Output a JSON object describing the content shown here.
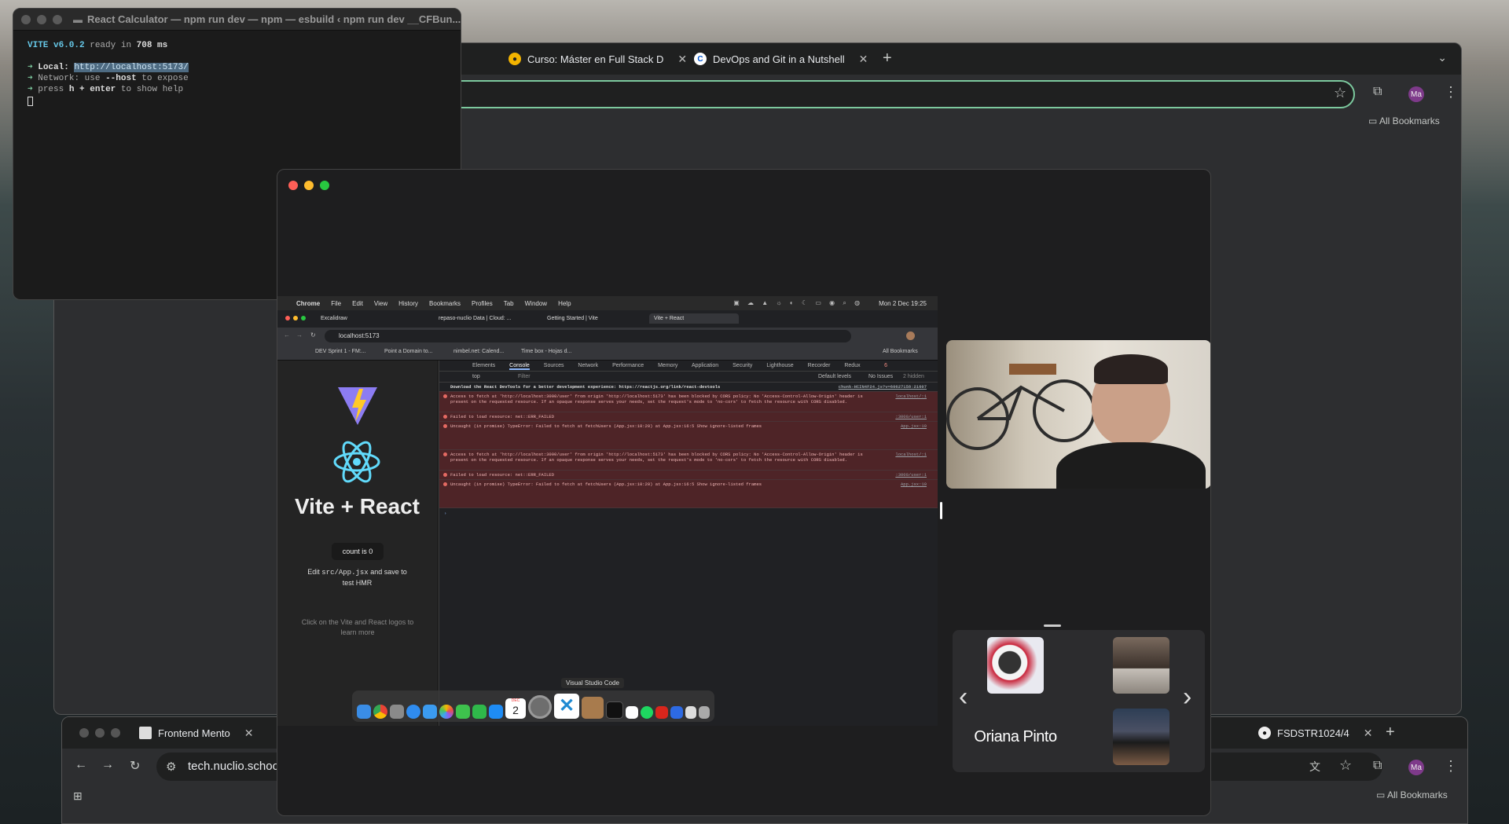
{
  "terminal": {
    "title": "React Calculator — npm run dev — npm — esbuild ‹ npm run dev __CFBun...",
    "vite_name": "VITE v6.0.2",
    "ready_text": "ready in",
    "ready_ms": "708 ms",
    "local_label": "Local:",
    "local_url": "http://localhost:5173/",
    "network_label": "Network:",
    "network_pre": "use",
    "network_flag": "--host",
    "network_post": "to expose",
    "help_pre": "press",
    "help_key": "h + enter",
    "help_post": "to show help"
  },
  "back_browser": {
    "tabs": [
      {
        "label": "Curso: Máster en Full Stack D"
      },
      {
        "label": "DevOps and Git in a Nutshell"
      }
    ],
    "all_bookmarks": "All Bookmarks",
    "profile_initials": "Ma"
  },
  "bottom_browser": {
    "tabs": [
      {
        "label": "Frontend Mento"
      },
      {
        "label": "FSDSTR1024/4"
      }
    ],
    "url": "tech.nuclio.schoo",
    "all_bookmarks": "All Bookmarks",
    "profile_initials": "Ma"
  },
  "shared_screen": {
    "macos_menu": [
      "Chrome",
      "File",
      "Edit",
      "View",
      "History",
      "Bookmarks",
      "Profiles",
      "Tab",
      "Window",
      "Help"
    ],
    "clock": "Mon 2 Dec 19:25",
    "tabs": [
      {
        "label": "Excalidraw"
      },
      {
        "label": "repaso-nuclio Data | Cloud: ..."
      },
      {
        "label": "Getting Started | Vite"
      },
      {
        "label": "Vite + React"
      }
    ],
    "url": "localhost:5173",
    "bookmarks": [
      "DEV Sprint 1 - FM:...",
      "Point a Domain to...",
      "nimbel.net: Calend...",
      "Time box - Hojas d..."
    ],
    "all_bookmarks": "All Bookmarks",
    "app_title": "Vite + React",
    "count_button": "count is 0",
    "edit_pre": "Edit",
    "edit_code": "src/App.jsx",
    "edit_post": "and save to test HMR",
    "read_docs": "Click on the Vite and React logos to learn more",
    "devtools_tabs": [
      "Elements",
      "Console",
      "Sources",
      "Network",
      "Performance",
      "Memory",
      "Application",
      "Security",
      "Lighthouse",
      "Recorder",
      "Redux"
    ],
    "error_count": "6",
    "context": "top",
    "filter_placeholder": "Filter",
    "levels": "Default levels",
    "issues": "No Issues",
    "hidden": "2 hidden",
    "console_lines": [
      {
        "text": "Download the React DevTools for a better development experience: https://reactjs.org/link/react-devtools",
        "src": "chunk-HCIN4F24.js?v=60627158:21607",
        "type": "info"
      },
      {
        "text": "Access to fetch at 'http://localhost:3000/user' from origin 'http://localhost:5173' has been blocked by CORS policy: No 'Access-Control-Allow-Origin' header is present on the requested resource. If an opaque response serves your needs, set the request's mode to 'no-cors' to fetch the resource with CORS disabled.",
        "src": "localhost/:1",
        "type": "err"
      },
      {
        "text": "Failed to load resource: net::ERR_FAILED",
        "src": ":3000/user:1",
        "type": "err"
      },
      {
        "text": "Uncaught (in promise) TypeError: Failed to fetch   at fetchUsers (App.jsx:10:20)   at App.jsx:16:5   Show ignore-listed frames",
        "src": "App.jsx:10",
        "type": "err"
      },
      {
        "text": "Access to fetch at 'http://localhost:3000/user' from origin 'http://localhost:5173' has been blocked by CORS policy: No 'Access-Control-Allow-Origin' header is present on the requested resource. If an opaque response serves your needs, set the request's mode to 'no-cors' to fetch the resource with CORS disabled.",
        "src": "localhost/:1",
        "type": "err"
      },
      {
        "text": "Failed to load resource: net::ERR_FAILED",
        "src": ":3000/user:1",
        "type": "err"
      },
      {
        "text": "Uncaught (in promise) TypeError: Failed to fetch   at fetchUsers (App.jsx:10:20)   at App.jsx:16:5   Show ignore-listed frames",
        "src": "App.jsx:10",
        "type": "err"
      }
    ],
    "dock_tooltip": "Visual Studio Code",
    "calendar_day": "2",
    "calendar_month": "DEC"
  },
  "meeting": {
    "participant_name": "Oriana Pinto"
  }
}
